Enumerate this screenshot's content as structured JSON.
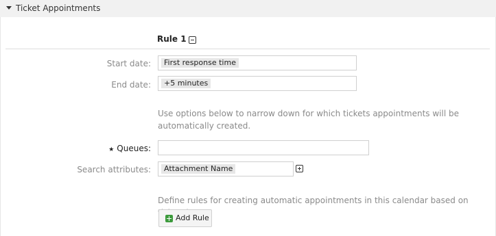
{
  "panel": {
    "title": "Ticket Appointments"
  },
  "rule": {
    "heading": "Rule 1",
    "start_date": {
      "label": "Start date:",
      "value": "First response time"
    },
    "end_date": {
      "label": "End date:",
      "value": "+5 minutes"
    },
    "narrow_help": "Use options below to narrow down for which tickets appointments will be automatically created.",
    "queues": {
      "star": "★",
      "label": "Queues:",
      "value": ""
    },
    "search_attributes": {
      "label": "Search attributes:",
      "value": "Attachment Name"
    }
  },
  "footer": {
    "help": "Define rules for creating automatic appointments in this calendar based on ticket data.",
    "add_rule_label": "Add Rule"
  }
}
